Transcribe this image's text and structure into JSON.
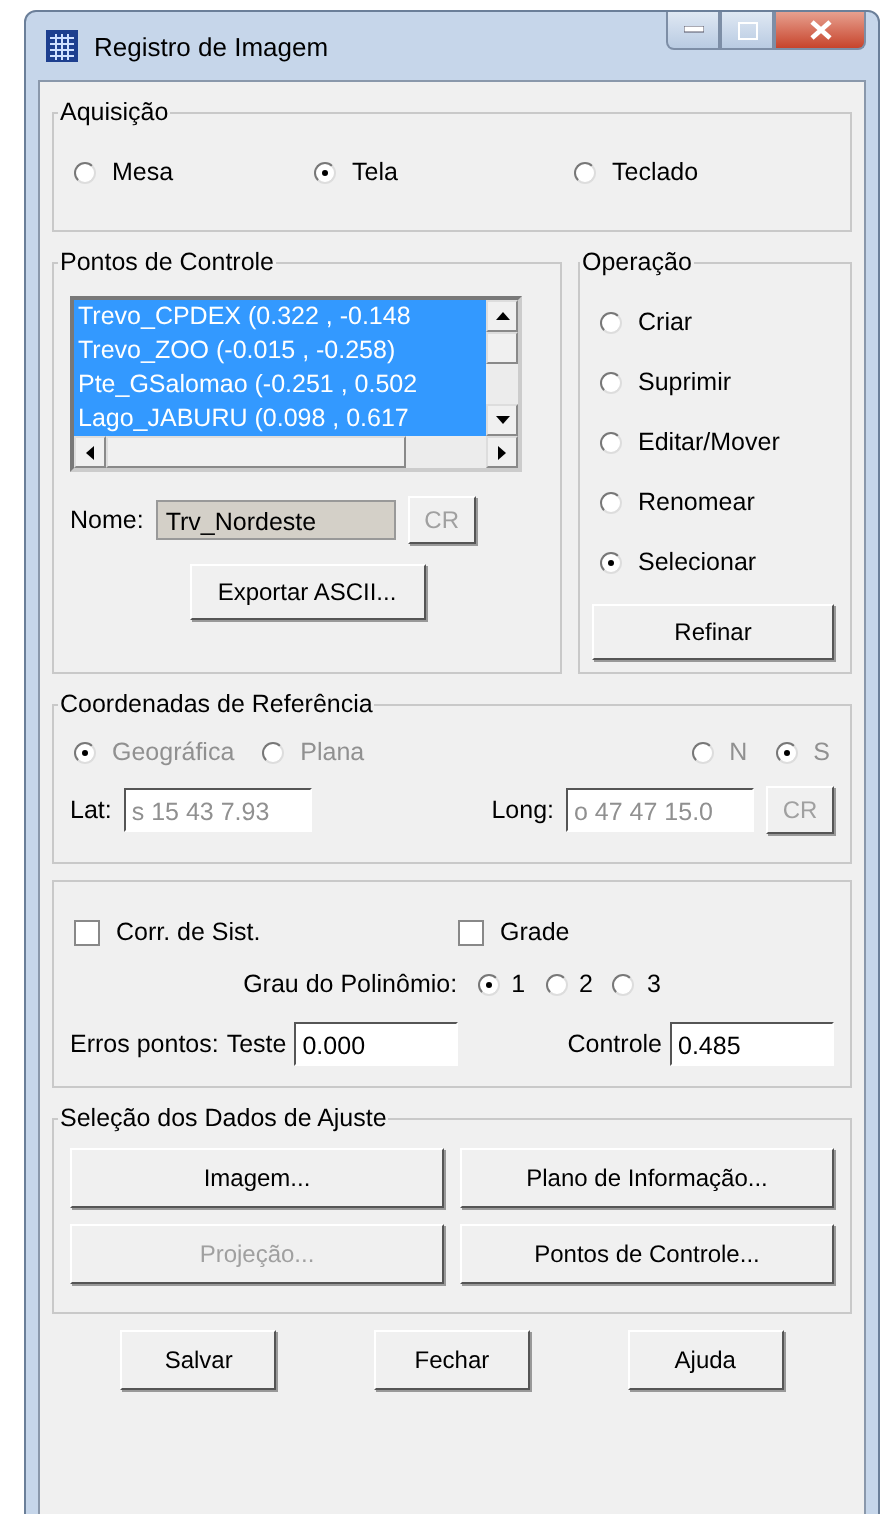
{
  "window": {
    "title": "Registro de Imagem"
  },
  "aquisicao": {
    "title": "Aquisição",
    "options": [
      {
        "label": "Mesa",
        "selected": false
      },
      {
        "label": "Tela",
        "selected": true
      },
      {
        "label": "Teclado",
        "selected": false
      }
    ]
  },
  "pontos": {
    "title": "Pontos de Controle",
    "items": [
      {
        "label": "Trevo_CPDEX (0.322 , -0.148",
        "selected": true
      },
      {
        "label": "Trevo_ZOO (-0.015 , -0.258)",
        "selected": true
      },
      {
        "label": "Pte_GSalomao (-0.251 , 0.502",
        "selected": true
      },
      {
        "label": "Lago_JABURU (0.098 , 0.617",
        "selected": true
      }
    ],
    "name_label": "Nome:",
    "name_value": "Trv_Nordeste",
    "cr_button": {
      "label": "CR",
      "disabled": true
    },
    "export_button": "Exportar ASCII..."
  },
  "operacao": {
    "title": "Operação",
    "options": [
      {
        "label": "Criar",
        "selected": false
      },
      {
        "label": "Suprimir",
        "selected": false
      },
      {
        "label": "Editar/Mover",
        "selected": false
      },
      {
        "label": "Renomear",
        "selected": false
      },
      {
        "label": "Selecionar",
        "selected": true
      }
    ],
    "refinar_button": "Refinar"
  },
  "coordenadas": {
    "title": "Coordenadas de Referência",
    "disabled": true,
    "system_options": [
      {
        "label": "Geográfica",
        "selected": true
      },
      {
        "label": "Plana",
        "selected": false
      }
    ],
    "hemisphere_options": [
      {
        "label": "N",
        "selected": false
      },
      {
        "label": "S",
        "selected": true
      }
    ],
    "lat_label": "Lat:",
    "lat_value": "s 15 43 7.93",
    "long_label": "Long:",
    "long_value": "o 47 47 15.0",
    "cr_button": {
      "label": "CR",
      "disabled": true
    }
  },
  "ajuste": {
    "checkboxes": [
      {
        "label": "Corr. de Sist.",
        "checked": false
      },
      {
        "label": "Grade",
        "checked": false
      }
    ],
    "grau_label": "Grau do Polinômio:",
    "grau_options": [
      {
        "label": "1",
        "selected": true
      },
      {
        "label": "2",
        "selected": false
      },
      {
        "label": "3",
        "selected": false
      }
    ],
    "erros_label": "Erros pontos:",
    "teste_label": "Teste",
    "teste_value": "0.000",
    "controle_label": "Controle",
    "controle_value": "0.485"
  },
  "selecao": {
    "title": "Seleção dos Dados de Ajuste",
    "buttons": [
      {
        "label": "Imagem...",
        "disabled": false
      },
      {
        "label": "Plano de Informação...",
        "disabled": false
      },
      {
        "label": "Projeção...",
        "disabled": true
      },
      {
        "label": "Pontos de Controle...",
        "disabled": false
      }
    ]
  },
  "buttons": [
    "Salvar",
    "Fechar",
    "Ajuda"
  ]
}
